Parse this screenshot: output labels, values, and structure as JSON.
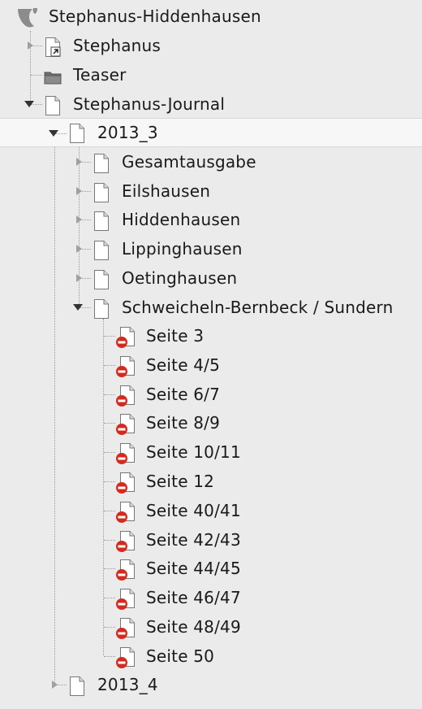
{
  "root": {
    "label": "Stephanus-Hiddenhausen",
    "icon": "typo3-logo-icon"
  },
  "level1": [
    {
      "label": "Stephanus",
      "icon": "page-shortcut-icon",
      "expander": "collapsed"
    },
    {
      "label": "Teaser",
      "icon": "folder-icon",
      "expander": "none"
    },
    {
      "label": "Stephanus-Journal",
      "icon": "page-icon",
      "expander": "expanded"
    }
  ],
  "level2": [
    {
      "label": "2013_3",
      "icon": "page-icon",
      "expander": "expanded",
      "selected": true
    },
    {
      "label": "2013_4",
      "icon": "page-icon",
      "expander": "collapsed",
      "selected": false
    }
  ],
  "level3": [
    {
      "label": "Gesamtausgabe",
      "icon": "page-icon",
      "expander": "collapsed"
    },
    {
      "label": "Eilshausen",
      "icon": "page-icon",
      "expander": "collapsed"
    },
    {
      "label": "Hiddenhausen",
      "icon": "page-icon",
      "expander": "collapsed"
    },
    {
      "label": "Lippinghausen",
      "icon": "page-icon",
      "expander": "collapsed"
    },
    {
      "label": "Oetinghausen",
      "icon": "page-icon",
      "expander": "collapsed"
    },
    {
      "label": "Schweicheln-Bernbeck / Sundern",
      "icon": "page-icon",
      "expander": "expanded"
    }
  ],
  "level4": [
    {
      "label": "Seite 3",
      "icon": "page-hidden-icon"
    },
    {
      "label": "Seite 4/5",
      "icon": "page-hidden-icon"
    },
    {
      "label": "Seite 6/7",
      "icon": "page-hidden-icon"
    },
    {
      "label": "Seite 8/9",
      "icon": "page-hidden-icon"
    },
    {
      "label": "Seite 10/11",
      "icon": "page-hidden-icon"
    },
    {
      "label": "Seite 12",
      "icon": "page-hidden-icon"
    },
    {
      "label": "Seite 40/41",
      "icon": "page-hidden-icon"
    },
    {
      "label": "Seite 42/43",
      "icon": "page-hidden-icon"
    },
    {
      "label": "Seite 44/45",
      "icon": "page-hidden-icon"
    },
    {
      "label": "Seite 46/47",
      "icon": "page-hidden-icon"
    },
    {
      "label": "Seite 48/49",
      "icon": "page-hidden-icon"
    },
    {
      "label": "Seite 50",
      "icon": "page-hidden-icon"
    }
  ],
  "colors": {
    "background": "#ebebeb",
    "selected_row": "#f7f7f7",
    "hidden_badge": "#d42b1e",
    "text": "#1a1a1a"
  }
}
